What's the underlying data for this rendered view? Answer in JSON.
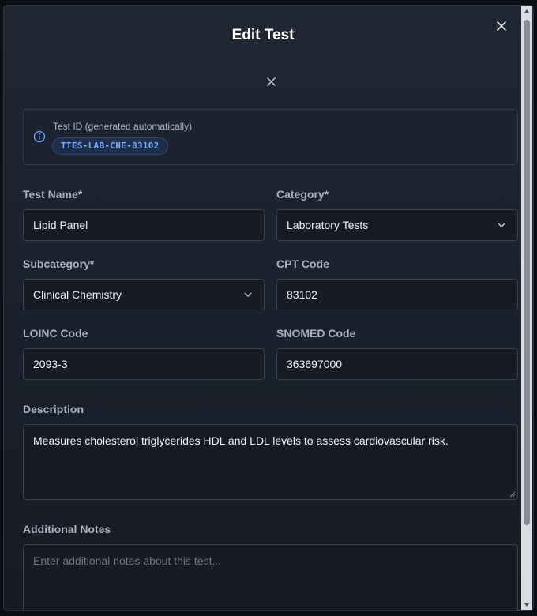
{
  "modal": {
    "title": "Edit Test"
  },
  "test_id": {
    "label": "Test ID (generated automatically)",
    "value": "TTES-LAB-CHE-83102"
  },
  "fields": {
    "test_name": {
      "label": "Test Name*",
      "value": "Lipid Panel"
    },
    "category": {
      "label": "Category*",
      "value": "Laboratory Tests"
    },
    "subcategory": {
      "label": "Subcategory*",
      "value": "Clinical Chemistry"
    },
    "cpt_code": {
      "label": "CPT Code",
      "value": "83102"
    },
    "loinc_code": {
      "label": "LOINC Code",
      "value": "2093-3"
    },
    "snomed_code": {
      "label": "SNOMED Code",
      "value": "363697000"
    },
    "description": {
      "label": "Description",
      "value": "Measures cholesterol triglycerides HDL and LDL levels to assess cardiovascular risk."
    },
    "additional_notes": {
      "label": "Additional Notes",
      "value": "",
      "placeholder": "Enter additional notes about this test..."
    }
  },
  "icons": {
    "close": "close-icon",
    "info": "info-icon",
    "chevron": "chevron-down-icon"
  },
  "colors": {
    "accent": "#7fb0ff",
    "chip_background": "#1d2d4a",
    "modal_background": "#1f2530"
  }
}
